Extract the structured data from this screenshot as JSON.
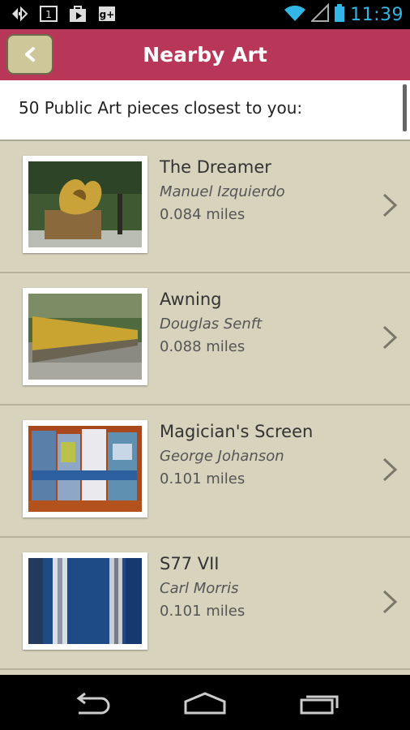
{
  "status_bar": {
    "time": "11:39",
    "notification_icons": [
      "debug-icon",
      "one-notification-icon",
      "play-store-icon",
      "google-plus-icon"
    ],
    "right_icons": [
      "wifi-icon",
      "signal-icon",
      "battery-icon"
    ],
    "accent_color": "#33b5e5"
  },
  "action_bar": {
    "title": "Nearby Art",
    "back_icon": "chevron-left-icon",
    "background": "#b83658",
    "back_button_color": "#cec79a"
  },
  "header": {
    "text": "50 Public Art pieces closest to you:"
  },
  "list": {
    "background": "#d7d3bd",
    "items": [
      {
        "title": "The Dreamer",
        "artist": "Manuel Izquierdo",
        "distance": "0.084 miles",
        "image": "dreamer-sculpture-photo"
      },
      {
        "title": "Awning",
        "artist": "Douglas Senft",
        "distance": "0.088 miles",
        "image": "awning-sculpture-photo"
      },
      {
        "title": "Magician's Screen",
        "artist": "George Johanson",
        "distance": "0.101 miles",
        "image": "magicians-screen-photo"
      },
      {
        "title": "S77 VII",
        "artist": "Carl Morris",
        "distance": "0.101 miles",
        "image": "s77-painting-photo"
      }
    ]
  },
  "nav_bar": {
    "buttons": [
      "back-nav-icon",
      "home-nav-icon",
      "recents-nav-icon"
    ]
  }
}
